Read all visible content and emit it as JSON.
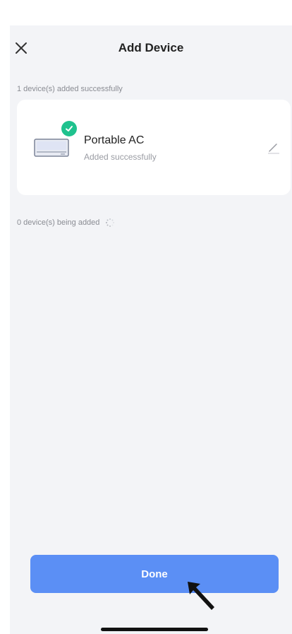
{
  "header": {
    "title": "Add Device",
    "close_icon": "close-icon"
  },
  "sections": {
    "added_label": "1 device(s) added successfully",
    "adding_label": "0 device(s) being added"
  },
  "device": {
    "name": "Portable AC",
    "status": "Added successfully",
    "icon": "air-conditioner-icon",
    "badge_icon": "check-icon",
    "edit_icon": "edit-pencil-icon"
  },
  "footer": {
    "done_label": "Done"
  },
  "colors": {
    "accent": "#5b8ff5",
    "success": "#1fc28e",
    "background": "#f3f4f7"
  }
}
